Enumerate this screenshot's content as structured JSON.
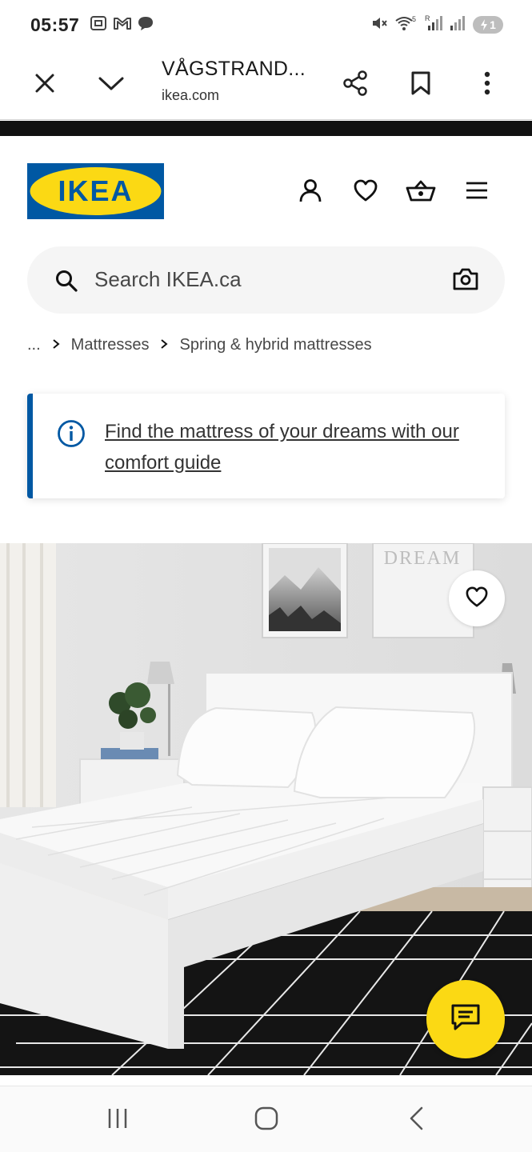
{
  "status_bar": {
    "time": "05:57",
    "left_icons": [
      "screenshot-icon",
      "gmail-icon",
      "chat-bubble-icon"
    ],
    "right_icons": [
      "mute-icon",
      "wifi-icon",
      "signal-icon",
      "signal-icon"
    ],
    "battery": "1"
  },
  "browser": {
    "tab_title": "VÅGSTRAND...",
    "url": "ikea.com",
    "actions": [
      "close-icon",
      "chevron-down-icon",
      "share-icon",
      "bookmark-icon",
      "more-vert-icon"
    ]
  },
  "header": {
    "logo_text": "IKEA",
    "colors": {
      "brand_blue": "#0058a3",
      "brand_yellow": "#fbd914"
    },
    "icons": [
      "account-icon",
      "heart-icon",
      "basket-icon",
      "menu-icon"
    ]
  },
  "search": {
    "placeholder": "Search IKEA.ca"
  },
  "breadcrumb": {
    "ellipsis": "...",
    "items": [
      "Mattresses",
      "Spring & hybrid mattresses"
    ]
  },
  "info_card": {
    "link_text": "Find the mattress of your dreams with our comfort guide"
  },
  "hero": {
    "wall_sign_text": "DREAM"
  }
}
